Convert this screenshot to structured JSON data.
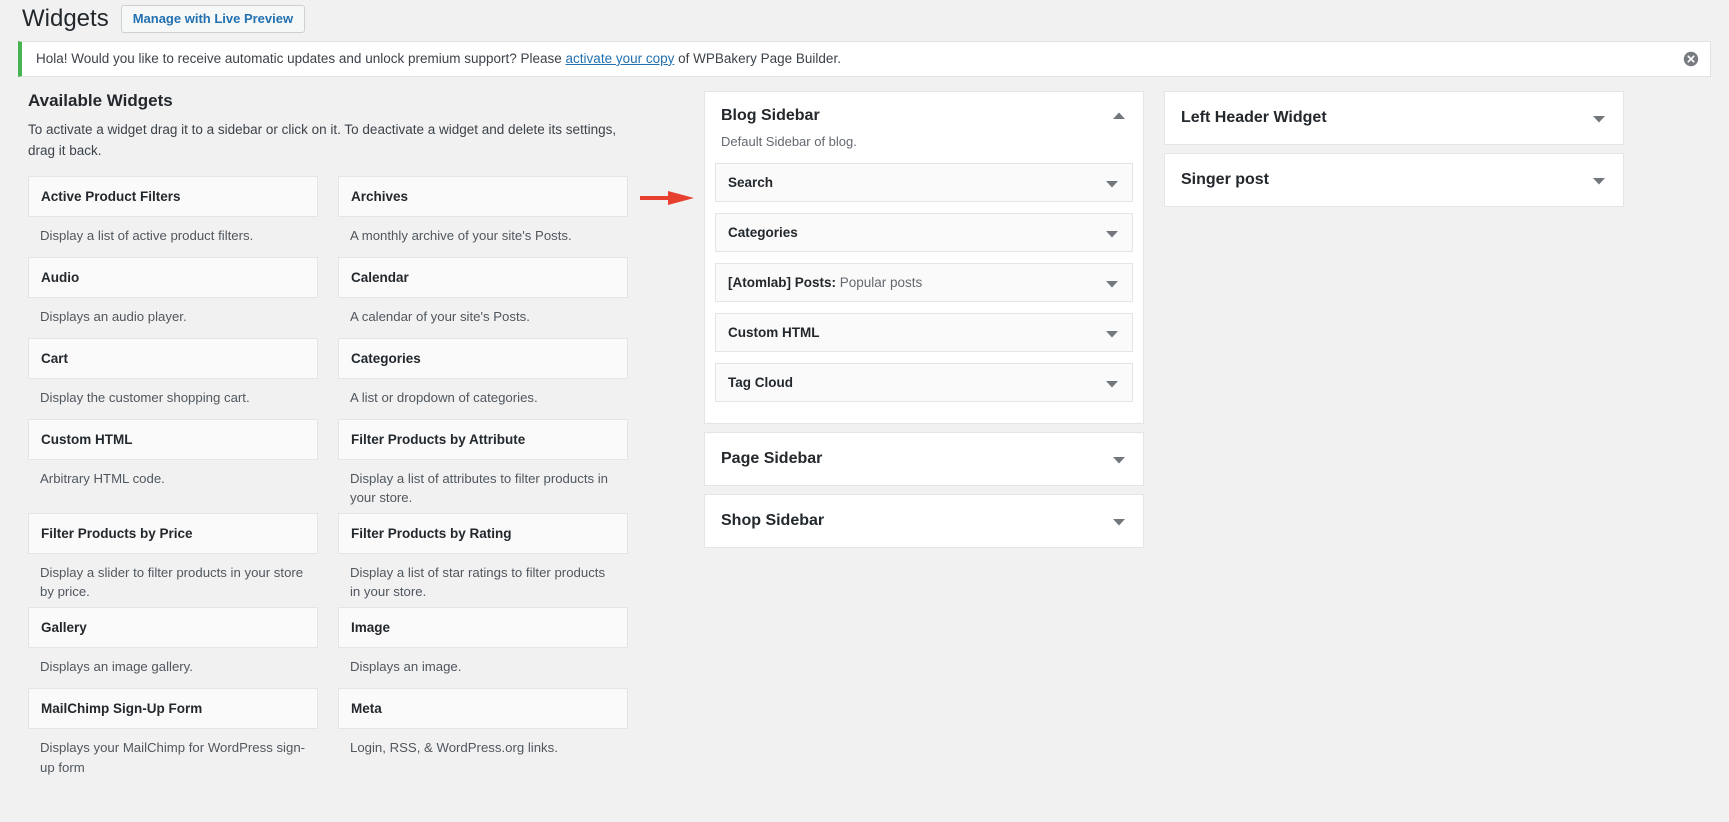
{
  "header": {
    "title": "Widgets",
    "live_preview_label": "Manage with Live Preview"
  },
  "notice": {
    "text_before": "Hola! Would you like to receive automatic updates and unlock premium support? Please ",
    "link_text": "activate your copy",
    "text_after": " of WPBakery Page Builder.",
    "dismiss_icon": "close-circle-icon",
    "accent_color": "#46b450"
  },
  "available": {
    "title": "Available Widgets",
    "description": "To activate a widget drag it to a sidebar or click on it. To deactivate a widget and delete its settings, drag it back.",
    "widgets": [
      {
        "name": "Active Product Filters",
        "desc": "Display a list of active product filters."
      },
      {
        "name": "Archives",
        "desc": "A monthly archive of your site's Posts."
      },
      {
        "name": "Audio",
        "desc": "Displays an audio player."
      },
      {
        "name": "Calendar",
        "desc": "A calendar of your site's Posts."
      },
      {
        "name": "Cart",
        "desc": "Display the customer shopping cart."
      },
      {
        "name": "Categories",
        "desc": "A list or dropdown of categories."
      },
      {
        "name": "Custom HTML",
        "desc": "Arbitrary HTML code."
      },
      {
        "name": "Filter Products by Attribute",
        "desc": "Display a list of attributes to filter products in your store."
      },
      {
        "name": "Filter Products by Price",
        "desc": "Display a slider to filter products in your store by price."
      },
      {
        "name": "Filter Products by Rating",
        "desc": "Display a list of star ratings to filter products in your store."
      },
      {
        "name": "Gallery",
        "desc": "Displays an image gallery."
      },
      {
        "name": "Image",
        "desc": "Displays an image."
      },
      {
        "name": "MailChimp Sign-Up Form",
        "desc": "Displays your MailChimp for WordPress sign-up form"
      },
      {
        "name": "Meta",
        "desc": "Login, RSS, & WordPress.org links."
      }
    ]
  },
  "annotation": {
    "arrow_color": "#e8402f",
    "arrow_name": "red-arrow-pointing-to-blog-sidebar"
  },
  "sidebars_main": [
    {
      "name": "Blog Sidebar",
      "description": "Default Sidebar of blog.",
      "expanded": true,
      "toggle_icon": "chevron-up-icon",
      "widgets": [
        {
          "title": "Search",
          "sub": ""
        },
        {
          "title": "Categories",
          "sub": ""
        },
        {
          "title": "[Atomlab] Posts:",
          "sub": " Popular posts"
        },
        {
          "title": "Custom HTML",
          "sub": ""
        },
        {
          "title": "Tag Cloud",
          "sub": ""
        }
      ]
    },
    {
      "name": "Page Sidebar",
      "description": "",
      "expanded": false,
      "toggle_icon": "chevron-down-icon",
      "widgets": []
    },
    {
      "name": "Shop Sidebar",
      "description": "",
      "expanded": false,
      "toggle_icon": "chevron-down-icon",
      "widgets": []
    }
  ],
  "sidebars_extra": [
    {
      "name": "Left Header Widget",
      "expanded": false,
      "toggle_icon": "chevron-down-icon"
    },
    {
      "name": "Singer post",
      "expanded": false,
      "toggle_icon": "chevron-down-icon"
    }
  ]
}
